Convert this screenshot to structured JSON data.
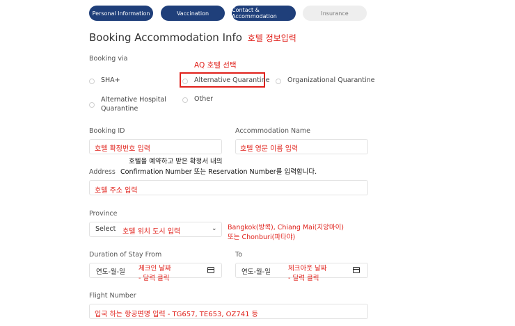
{
  "steps": [
    {
      "label": "Personal Information",
      "active": true
    },
    {
      "label": "Vaccination",
      "active": true
    },
    {
      "label": "Contact & Accommodation",
      "active": true
    },
    {
      "label": "Insurance",
      "active": false
    }
  ],
  "header": {
    "title": "Booking Accommodation Info",
    "title_note": "호텔 정보입력"
  },
  "booking_via": {
    "label": "Booking via",
    "annotation": "AQ 호텔 선택",
    "options": [
      "SHA+",
      "Alternative Quarantine",
      "Organizational Quarantine",
      "Alternative Hospital Quarantine",
      "Other"
    ],
    "highlighted": "Alternative Quarantine"
  },
  "booking_id": {
    "label": "Booking ID",
    "note": "호텔 확정번호 입력"
  },
  "accommodation_name": {
    "label": "Accommodation Name",
    "note": "호텔 영문 이름 입력"
  },
  "confirmation_note": {
    "line1": "호텔을 예약하고 받은 확정서 내의",
    "line2": "Confirmation Number 또는 Reservation Number를 입력합니다."
  },
  "address": {
    "label": "Address",
    "note": "호텔 주소 입력"
  },
  "province": {
    "label": "Province",
    "selected": "Select",
    "note": "호텔 위치 도시 입력",
    "side_note_1": "Bangkok(방콕), Chiang Mai(치앙마이)",
    "side_note_2": "또는 Chonburi(파타야)"
  },
  "duration_from": {
    "label": "Duration of Stay From",
    "placeholder": "연도-월-일",
    "note_1": "체크인 날짜",
    "note_2": "- 달력 클릭"
  },
  "duration_to": {
    "label": "To",
    "placeholder": "연도-월-일",
    "note_1": "체크아웃 날짜",
    "note_2": "- 달력 클릭"
  },
  "flight_number": {
    "label": "Flight Number",
    "note": "입국 하는 항공편명 입력 - TG657, TE653, OZ741 등"
  },
  "colors": {
    "primary": "#1f3f7a",
    "annotation_red": "#e0201a",
    "inactive_step": "#eeeeee"
  }
}
